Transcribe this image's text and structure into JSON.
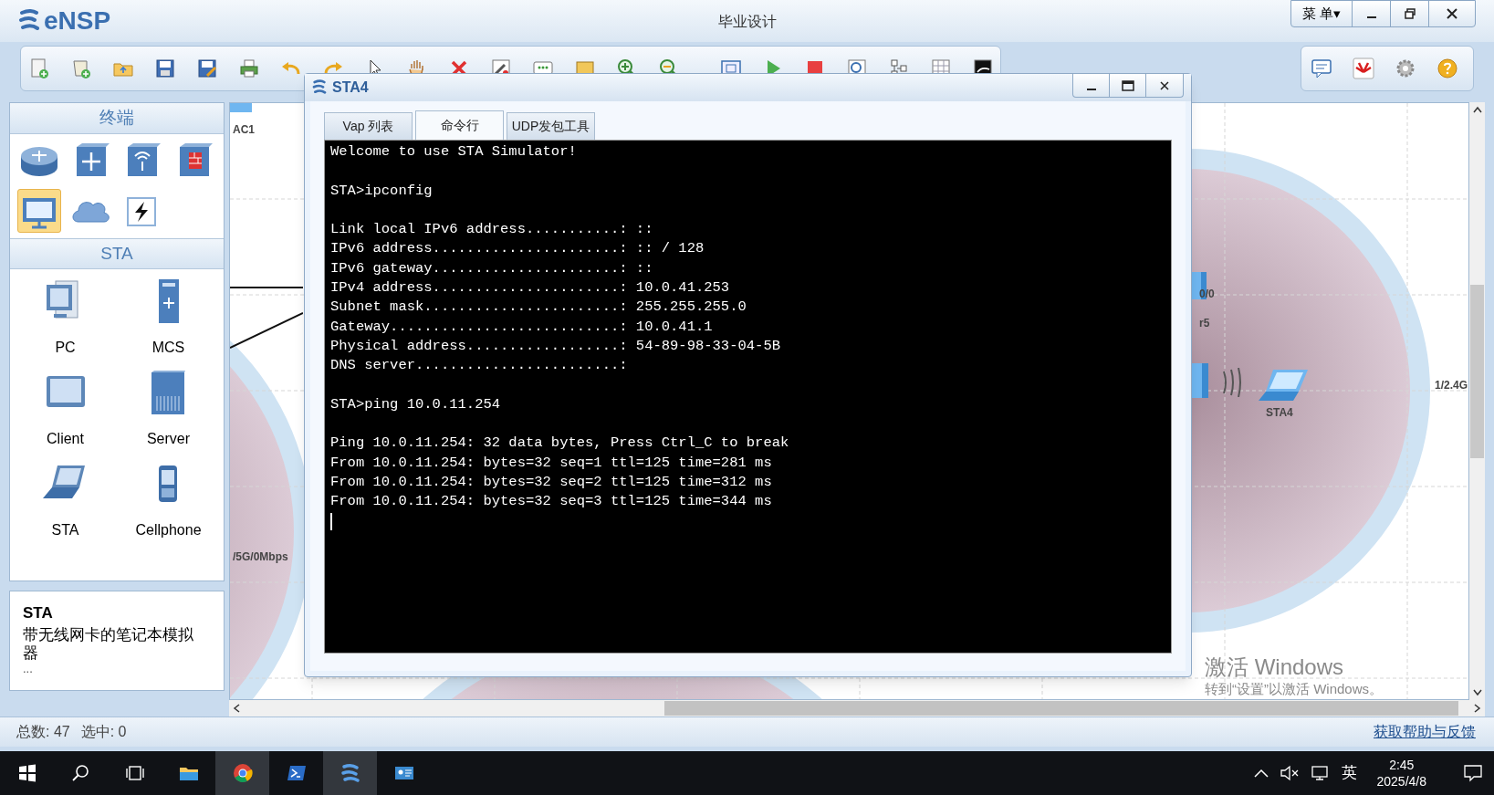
{
  "app": {
    "name": "eNSP",
    "title": "毕业设计",
    "menu": "菜 单▾"
  },
  "palette": {
    "category_title": "终端",
    "categories": [
      {
        "kind": "router",
        "selected": false
      },
      {
        "kind": "switch",
        "selected": false
      },
      {
        "kind": "wireless",
        "selected": false
      },
      {
        "kind": "firewall",
        "selected": false
      },
      {
        "kind": "terminal",
        "selected": true
      },
      {
        "kind": "cloud",
        "selected": false
      },
      {
        "kind": "other",
        "selected": false
      }
    ],
    "subcategory_title": "STA",
    "devices": [
      {
        "kind": "pc",
        "label": "PC"
      },
      {
        "kind": "mcs",
        "label": "MCS"
      },
      {
        "kind": "client",
        "label": "Client"
      },
      {
        "kind": "server",
        "label": "Server"
      },
      {
        "kind": "sta",
        "label": "STA"
      },
      {
        "kind": "cellphone",
        "label": "Cellphone"
      }
    ],
    "description": {
      "title": "STA",
      "text": "带无线网卡的笔记本模拟器",
      "more": "..."
    }
  },
  "canvas": {
    "labels": [
      {
        "text": "AC1"
      },
      {
        "text": "/5G/0Mbps"
      },
      {
        "text": "0/0"
      },
      {
        "text": "r5"
      },
      {
        "text": "STA4"
      },
      {
        "text": "1/2.4G"
      }
    ]
  },
  "sta_window": {
    "title": "STA4",
    "tabs": [
      {
        "label": "Vap 列表",
        "selected": false
      },
      {
        "label": "命令行",
        "selected": true
      },
      {
        "label": "UDP发包工具",
        "selected": false
      }
    ],
    "terminal_blocks": [
      [
        "Welcome to use STA Simulator!"
      ],
      [
        "STA>ipconfig"
      ],
      [
        "Link local IPv6 address...........: ::",
        "IPv6 address......................: :: / 128",
        "IPv6 gateway......................: ::",
        "IPv4 address......................: 10.0.41.253",
        "Subnet mask.......................: 255.255.255.0",
        "Gateway...........................: 10.0.41.1",
        "Physical address..................: 54-89-98-33-04-5B",
        "DNS server........................:"
      ],
      [
        "STA>ping 10.0.11.254"
      ],
      [
        "Ping 10.0.11.254: 32 data bytes, Press Ctrl_C to break",
        "From 10.0.11.254: bytes=32 seq=1 ttl=125 time=281 ms",
        "From 10.0.11.254: bytes=32 seq=2 ttl=125 time=312 ms",
        "From 10.0.11.254: bytes=32 seq=3 ttl=125 time=344 ms"
      ]
    ]
  },
  "status_bar": {
    "total": "总数: 47",
    "selected": "选中: 0",
    "help_link": "获取帮助与反馈"
  },
  "activation_notice": {
    "title": "激活 Windows",
    "text": "转到“设置”以激活 Windows。"
  },
  "taskbar": {
    "input_language": "英",
    "time": "2:45",
    "date": "2025/4/8"
  }
}
